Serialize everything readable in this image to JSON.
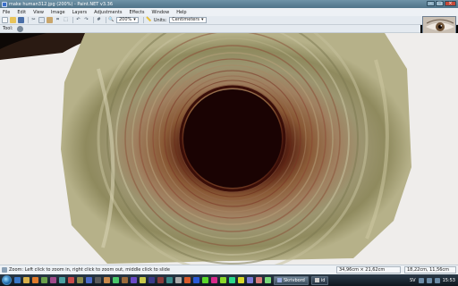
{
  "window": {
    "title": "make human312.jpg (200%) - Paint.NET v3.36"
  },
  "menu": [
    "File",
    "Edit",
    "View",
    "Image",
    "Layers",
    "Adjustments",
    "Effects",
    "Window",
    "Help"
  ],
  "toolbar": {
    "zoom_value": "200%",
    "units_label": "Units:",
    "units_value": "Centimeters"
  },
  "toolrow": {
    "tool_label": "Tool:"
  },
  "status": {
    "hint": "Zoom: Left click to zoom in, right click to zoom out, middle click to slide",
    "image_size": "34,96cm × 21,62cm",
    "cursor_pos": "18,22cm, 11,56cm"
  },
  "taskbar": {
    "buttons": [
      "Skrivbord",
      "id"
    ],
    "language": "SV",
    "clock": "15:53"
  },
  "colors": {
    "title_bar": "#5f8398",
    "taskbar": "#1c2a36",
    "ring_dark": "#2a0606",
    "ring_olive": "#8f8a5e"
  }
}
